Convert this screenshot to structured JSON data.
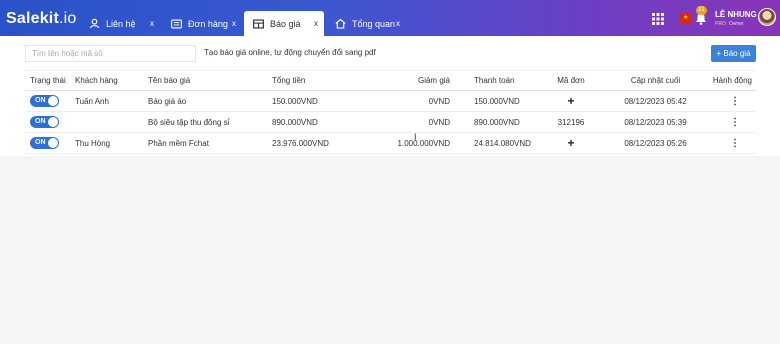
{
  "app": {
    "logo_main": "Salekit",
    "logo_suffix": ".io"
  },
  "tabs": [
    {
      "label": "Liên hệ",
      "icon": "user-icon",
      "close": "x"
    },
    {
      "label": "Đơn hàng",
      "icon": "list-icon",
      "close": "x"
    },
    {
      "label": "Báo giá",
      "icon": "table-icon",
      "close": "x",
      "active": true
    },
    {
      "label": "Tổng quan",
      "icon": "home-icon",
      "close": "x"
    }
  ],
  "header": {
    "notification_count": "21",
    "user_name": "LÊ NHUNG",
    "user_plan": "PRO",
    "user_role": "Owner"
  },
  "toolbar": {
    "search_placeholder": "Tìm tên hoặc mã số",
    "hint": "Tạo báo giá online, tự động chuyển đổi sang pdf",
    "add_label": "+ Báo giá"
  },
  "table": {
    "columns": [
      "Trạng thái",
      "Khách hàng",
      "Tên báo giá",
      "Tổng tiền",
      "Giảm giá",
      "Thanh toán",
      "Mã đơn",
      "Cập nhật cuối",
      "Hành động"
    ],
    "rows": [
      {
        "status": "ON",
        "customer": "Tuấn Anh",
        "name": "Báo giá áo",
        "total": "150.000VND",
        "discount": "0VND",
        "payment": "150.000VND",
        "order": "+",
        "updated": "08/12/2023 05:42",
        "action": "⋮"
      },
      {
        "status": "ON",
        "customer": "",
        "name": "Bộ siêu tập thu đông sỉ",
        "total": "890.000VND",
        "discount": "0VND",
        "payment": "890.000VND",
        "order": "312196",
        "updated": "08/12/2023 05:39",
        "action": "⋮"
      },
      {
        "status": "ON",
        "customer": "Thu Hòng",
        "name": "Phần mềm Fchat",
        "total": "23.976.000VND",
        "discount": "1.000.000VND",
        "payment": "24.814.080VND",
        "order": "+",
        "updated": "08/12/2023 05:26",
        "action": "⋮"
      }
    ]
  },
  "colors": {
    "accent": "#3b82d8",
    "toggle_on": "#2f70d6",
    "topbar_start": "#2a52c9",
    "topbar_end": "#8a35b8"
  }
}
